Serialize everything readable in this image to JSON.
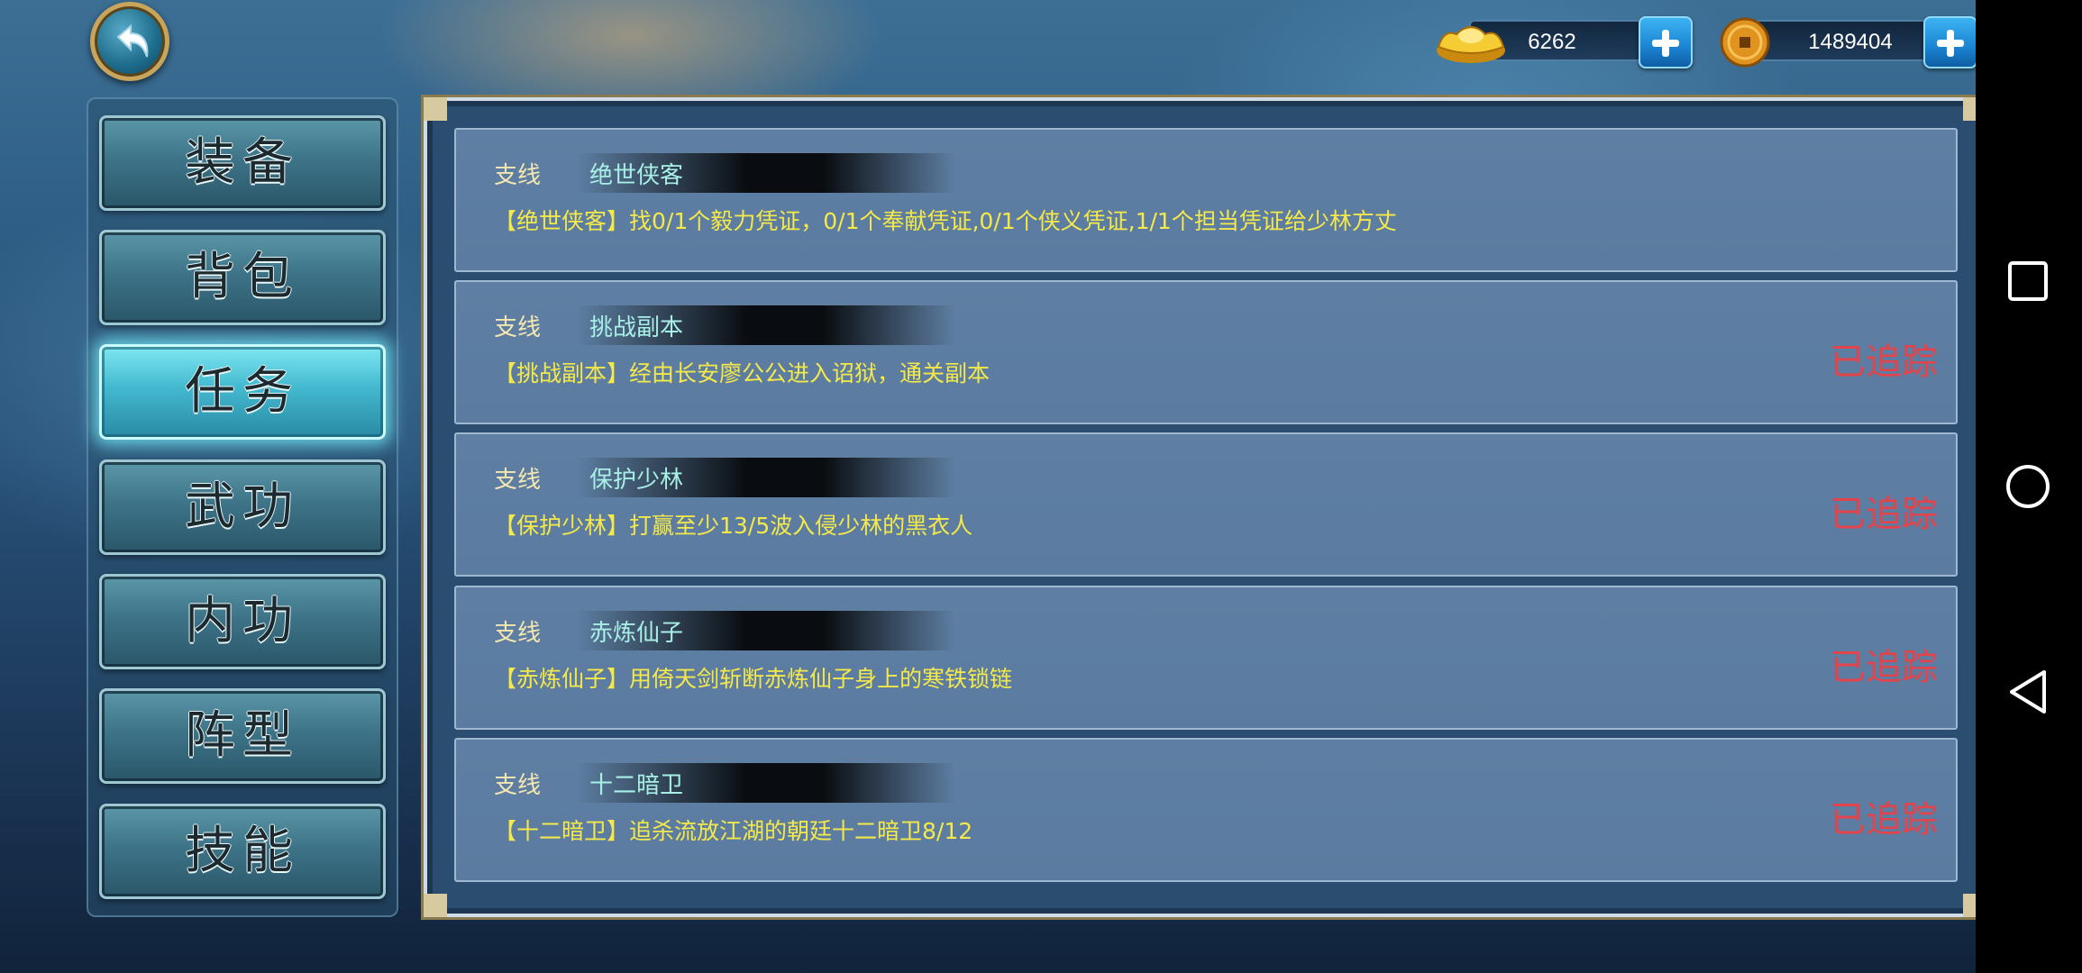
{
  "currency": {
    "gold": {
      "value": "6262",
      "icon": "gold-ingot-icon"
    },
    "coins": {
      "value": "1489404",
      "icon": "copper-coin-icon"
    }
  },
  "menu": [
    {
      "label": "装备",
      "active": false
    },
    {
      "label": "背包",
      "active": false
    },
    {
      "label": "任务",
      "active": true
    },
    {
      "label": "武功",
      "active": false
    },
    {
      "label": "内功",
      "active": false
    },
    {
      "label": "阵型",
      "active": false
    },
    {
      "label": "技能",
      "active": false
    }
  ],
  "quests": [
    {
      "type": "支线",
      "name": "绝世侠客",
      "desc": "【绝世侠客】找0/1个毅力凭证，0/1个奉献凭证,0/1个侠义凭证,1/1个担当凭证给少林方丈",
      "status": ""
    },
    {
      "type": "支线",
      "name": "挑战副本",
      "desc": "【挑战副本】经由长安廖公公进入诏狱，通关副本",
      "status": "已追踪"
    },
    {
      "type": "支线",
      "name": "保护少林",
      "desc": "【保护少林】打赢至少13/5波入侵少林的黑衣人",
      "status": "已追踪"
    },
    {
      "type": "支线",
      "name": "赤炼仙子",
      "desc": "【赤炼仙子】用倚天剑斩断赤炼仙子身上的寒铁锁链",
      "status": "已追踪"
    },
    {
      "type": "支线",
      "name": "十二暗卫",
      "desc": "【十二暗卫】追杀流放江湖的朝廷十二暗卫8/12",
      "status": "已追踪"
    }
  ],
  "colors": {
    "tracked": "#e3434b",
    "quest_desc": "#f5e94a",
    "quest_name": "#a8f0e6"
  }
}
